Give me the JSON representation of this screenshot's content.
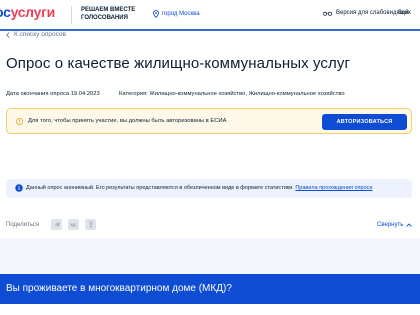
{
  "header": {
    "logo_part1": "ос",
    "logo_part2": "услуги",
    "tagline_line1": "РЕШАЕМ ВМЕСТЕ",
    "tagline_line2": "ГОЛОСОВАНИЯ",
    "location": "город Москва",
    "accessibility": "Версия для слабовидящих",
    "login": "Вой"
  },
  "breadcrumb": {
    "back_label": "К списку опросов"
  },
  "survey": {
    "title": "Опрос о качестве жилищно-коммунальных услуг",
    "end_date_label": "Дата окончания опроса",
    "end_date": "19.04.2023",
    "category_label": "Категория:",
    "category": "Жилищно-коммунальное хозяйство, Жилищно-коммунальное хозяйство"
  },
  "warning": {
    "text": "Для того, чтобы принять участие, вы должны быть авторизованы в ЕСИА",
    "button_label": "АВТОРИЗОВАТЬСЯ"
  },
  "info": {
    "text": "Данный опрос анонимный. Его результаты представляются в обезличенном виде в формате статистики.",
    "link_label": "Правила прохождения опроса"
  },
  "share": {
    "label": "Поделиться",
    "collapse_label": "Свернуть"
  },
  "question": {
    "text": "Вы проживаете в многоквартирном доме (МКД)?"
  },
  "colors": {
    "accent": "#0d4cd3",
    "brand_red": "#ee3f58",
    "warning_bg": "#fef8e9",
    "warning_border": "#f5cd6e",
    "info_bg": "#edf2fe"
  },
  "icons": [
    "location-pin-icon",
    "glasses-icon",
    "chevron-left-icon",
    "alert-icon",
    "info-icon",
    "telegram-icon",
    "vk-icon",
    "ok-icon",
    "chevron-up-icon"
  ]
}
